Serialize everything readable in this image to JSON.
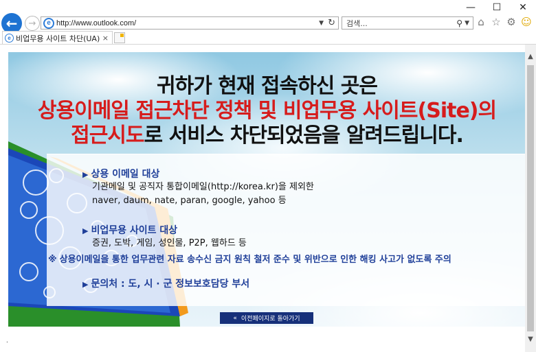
{
  "window": {
    "minimize": "—",
    "maximize": "☐",
    "close": "✕"
  },
  "toolbar": {
    "back": "←",
    "forward": "→",
    "address": "http://www.outlook.com/",
    "search_placeholder": "검색...",
    "favicon": "e"
  },
  "tab": {
    "label": "비업무용 사이트 차단(UA)",
    "close": "×"
  },
  "banner": {
    "line1": "귀하가 현재 접속하신 곳은",
    "line2": "상용이메일 접근차단 정책 및  비업무용 사이트(Site)의",
    "line3_red": "접근시도",
    "line3_rest": "로 서비스 차단되었음을 알려드립니다.",
    "items": [
      {
        "title": "상용 이메일 대상",
        "lines": [
          "기관메일 및 공직자 통합이메일(http://korea.kr)을 제외한",
          "naver, daum, nate, paran, google, yahoo 등"
        ]
      },
      {
        "title": "비업무용 사이트 대상",
        "lines": [
          "증권, 도박, 게임, 성인물, P2P, 웹하드 등"
        ]
      },
      {
        "title": "문의처 : 도, 시 · 군 정보보호담당 부서",
        "lines": []
      }
    ],
    "note_symbol": "※",
    "note": "상용이메일을 통한 업무관련 자료 송수신 금지 원칙 철저 준수 및 위반으로 인한 해킹 사고가 없도록 주의",
    "back_button": "이전페이지로 돌아가기",
    "back_chevron": "«"
  },
  "footer_dot": ".",
  "colors": {
    "accent_red": "#d61c1c",
    "accent_blue": "#1f3f99",
    "button_navy": "#16307a"
  }
}
